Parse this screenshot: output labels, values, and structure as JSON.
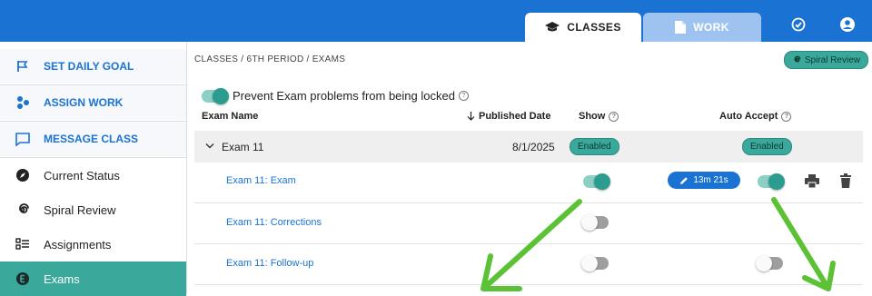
{
  "header": {
    "tabs": [
      {
        "label": "CLASSES",
        "icon": "graduation-cap-icon",
        "active": true
      },
      {
        "label": "WORK",
        "icon": "document-icon",
        "active": false
      }
    ],
    "icons": [
      "check-circle-icon",
      "account-icon"
    ]
  },
  "sidebar": {
    "actions": [
      {
        "label": "SET DAILY GOAL",
        "icon": "flag-icon"
      },
      {
        "label": "ASSIGN WORK",
        "icon": "assign-icon"
      },
      {
        "label": "MESSAGE CLASS",
        "icon": "message-icon"
      }
    ],
    "nav": [
      {
        "label": "Current Status",
        "icon": "compass-icon"
      },
      {
        "label": "Spiral Review",
        "icon": "spiral-icon"
      },
      {
        "label": "Assignments",
        "icon": "list-icon"
      },
      {
        "label": "Exams",
        "icon": "exam-icon",
        "active": true
      }
    ]
  },
  "main": {
    "breadcrumb": "CLASSES / 6TH PERIOD / EXAMS",
    "spiral_badge": "Spiral Review",
    "prevent_lock": {
      "label": "Prevent Exam problems from being locked",
      "on": true
    },
    "columns": {
      "name": "Exam Name",
      "published": "Published Date",
      "show": "Show",
      "auto_accept": "Auto Accept"
    },
    "group": {
      "name": "Exam 11",
      "date": "8/1/2025",
      "show_status": "Enabled",
      "auto_status": "Enabled"
    },
    "rows": [
      {
        "name": "Exam 11: Exam",
        "show_on": true,
        "timer": "13m 21s",
        "auto_on": true
      },
      {
        "name": "Exam 11: Corrections",
        "show_on": false
      },
      {
        "name": "Exam 11: Follow-up",
        "show_on": false,
        "auto_on": false
      }
    ]
  },
  "colors": {
    "primary": "#1a73d3",
    "teal": "#3aa89a",
    "annotation_arrow": "#5bc236"
  }
}
